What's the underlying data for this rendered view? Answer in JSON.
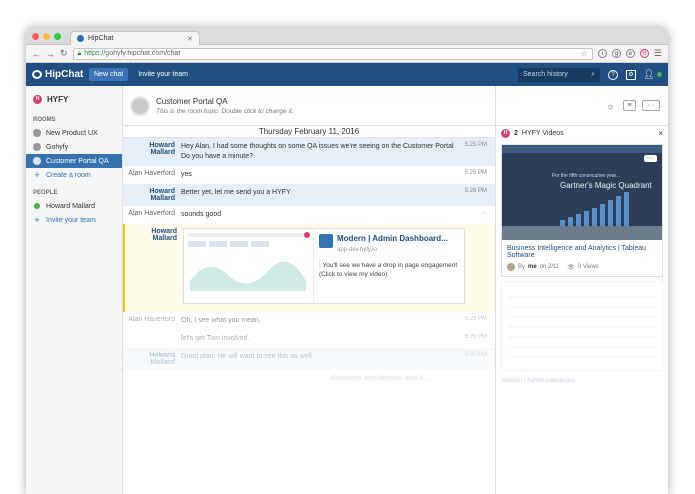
{
  "browser": {
    "tab_title": "HipChat",
    "url_scheme": "https://",
    "url_host": "gohyfy.hipchat.com",
    "url_path": "/chat"
  },
  "header": {
    "logo": "HipChat",
    "new_chat": "New chat",
    "invite": "Invite your team",
    "search_placeholder": "Search history"
  },
  "sidebar": {
    "team_badge": "H",
    "team_name": "HYFY",
    "rooms_label": "ROOMS",
    "rooms": [
      {
        "label": "New Product UX"
      },
      {
        "label": "Gohyfy"
      },
      {
        "label": "Customer Portal QA"
      }
    ],
    "create_room": "Create a room",
    "people_label": "PEOPLE",
    "people": [
      {
        "label": "Howard Mallard"
      }
    ],
    "invite_team": "Invite your team"
  },
  "room": {
    "name": "Customer Portal QA",
    "topic": "This is the room topic. Double click to change it.",
    "date": "Thursday February 11, 2016"
  },
  "messages": [
    {
      "from": "Howard Mallard",
      "text": "Hey Alan, I had some thoughts on some QA issues we're seeing on the Customer Portal",
      "time": "5:25 PM"
    },
    {
      "from": "",
      "text": "Do you have a minute?",
      "time": ""
    },
    {
      "from": "Alan Haverford",
      "text": "yes",
      "time": "5:25 PM"
    },
    {
      "from": "Howard Mallard",
      "text": "Better yet, let me send you a HYFY",
      "time": "5:26 PM"
    },
    {
      "from": "Alan Haverford",
      "text": "sounds good",
      "time": ""
    },
    {
      "from": "Howard Mallard",
      "video_title": "Modern | Admin Dashboard...",
      "video_url": "app-dev.hyfy.io",
      "video_desc": ": You'll see we have a drop in page engagement (Click to view my video)"
    },
    {
      "from": "Alan Haverford",
      "text": "Oh, I see what you mean.",
      "time": "5:25 PM"
    },
    {
      "from": "",
      "text": "let's get Tom involved.",
      "time": "5:25 PM"
    },
    {
      "from": "Howard Mallard",
      "text": "Good plan. He will want to see this as well.",
      "time": "5:25 PM"
    },
    {
      "from": "",
      "video_title": "Business Intelligence and A...",
      "time": ""
    }
  ],
  "panel": {
    "badge": "H",
    "count": "2",
    "title": "HYFY Videos",
    "close": "×",
    "video1": {
      "thumb_caption": "For the fifth consecutive year...",
      "thumb_heading": "Gartner's Magic Quadrant",
      "title": "Business Intelligence and Analytics | Tableau Software",
      "by": "By",
      "author": "me",
      "date": "on 2/11",
      "views": "0 Views"
    },
    "video2_caption": "Modern | Admin Dashboard"
  },
  "more_glyph": "···"
}
